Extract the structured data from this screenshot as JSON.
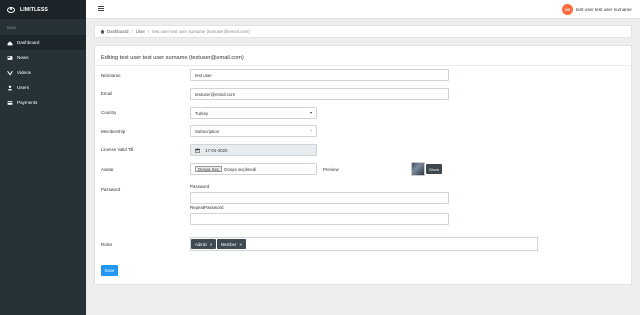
{
  "sidebar": {
    "brand": "LIMITLESS",
    "section_label": "MAIN",
    "items": [
      {
        "label": "Dashboard",
        "icon": "dashboard-icon"
      },
      {
        "label": "News",
        "icon": "news-icon"
      },
      {
        "label": "Videos",
        "icon": "videos-icon"
      },
      {
        "label": "Users",
        "icon": "user-icon"
      },
      {
        "label": "Payments",
        "icon": "payments-icon"
      }
    ]
  },
  "header": {
    "avatar_initials": "OG",
    "user_name": "test user test user surname"
  },
  "breadcrumb": {
    "home": "Dashboard",
    "sep": "/",
    "user": "User",
    "current": "test user test user surname (testuser@email.com)"
  },
  "form": {
    "title": "Editing test user test user surname (testuser@email.com)",
    "nickname": {
      "label": "Nickname",
      "value": "test user"
    },
    "email": {
      "label": "Email",
      "value": "testuser@email.com"
    },
    "country": {
      "label": "Country",
      "value": "Turkey"
    },
    "membership": {
      "label": "Membership",
      "value": "Subscription",
      "chevron": "˅"
    },
    "license": {
      "label": "License Valid Till",
      "value": "17-04-2020"
    },
    "avatar": {
      "label": "Avatar",
      "file_button": "Dosya Seç",
      "file_status": "Dosya seçilmedi",
      "preview_label": "Preview",
      "show_button": "Show"
    },
    "password": {
      "label": "Password",
      "field_label": "Password",
      "repeat_label": "RepeatPassword"
    },
    "roles": {
      "label": "Roles",
      "tags": [
        {
          "label": "Admin",
          "remove": "×"
        },
        {
          "label": "Member",
          "remove": "×"
        }
      ]
    },
    "save_button": "Save"
  },
  "colors": {
    "sidebar_bg": "#263238",
    "accent": "#2196f3",
    "avatar_bg": "#ff6a3d",
    "tag_bg": "#3e4a52"
  }
}
